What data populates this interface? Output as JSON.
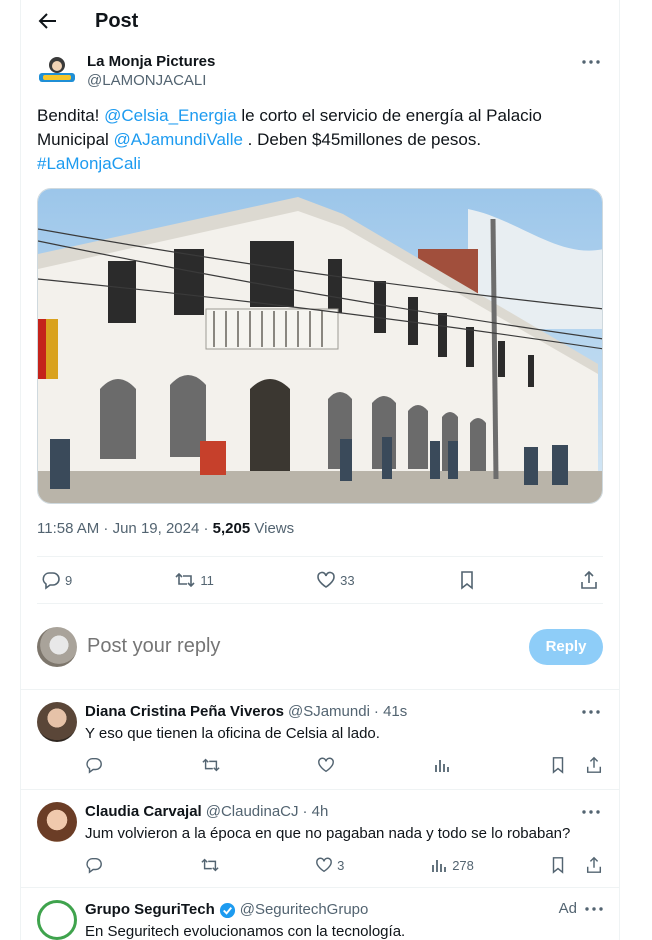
{
  "header": {
    "title": "Post"
  },
  "tweet": {
    "display_name": "La Monja Pictures",
    "handle": "@LAMONJACALI",
    "text_1": "Bendita! ",
    "mention_1": "@Celsia_Energia",
    "text_2": " le corto el servicio de energía al Palacio Municipal ",
    "mention_2": "@AJamundiValle",
    "text_3": " . Deben $45millones de pesos.",
    "hashtag": "#LaMonjaCali",
    "time": "11:58 AM · Jun 19, 2024 · ",
    "views_count": "5,205",
    "views_label": " Views",
    "replies": "9",
    "reposts": "11",
    "likes": "33"
  },
  "reply_box": {
    "placeholder": "Post your reply",
    "button": "Reply"
  },
  "replies": [
    {
      "name": "Diana Cristina Peña Viveros",
      "handle": "@SJamundi",
      "time": "· 41s",
      "text": "Y eso que tienen la oficina de Celsia al lado.",
      "likes": "",
      "views": ""
    },
    {
      "name": "Claudia Carvajal",
      "handle": "@ClaudinaCJ",
      "time": "· 4h",
      "text": "Jum volvieron a la época en que no pagaban nada y todo se lo robaban?",
      "likes": "3",
      "views": "278"
    },
    {
      "name": "Grupo SeguriTech",
      "handle": "@SeguritechGrupo",
      "ad": "Ad",
      "text": "En Seguritech evolucionamos con la tecnología."
    }
  ],
  "colors": {
    "link": "#1d9bf0",
    "muted": "#536471",
    "reply_button": "#8ecdf8",
    "verified": "#1d9bf0"
  }
}
